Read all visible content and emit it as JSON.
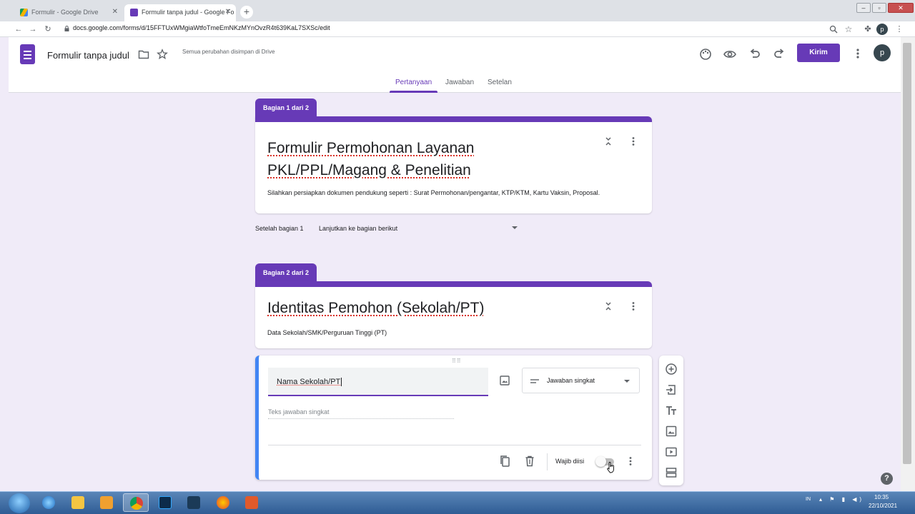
{
  "browser": {
    "tabs": [
      {
        "title": "Formulir - Google Drive",
        "active": false
      },
      {
        "title": "Formulir tanpa judul - Google Fo",
        "active": true
      }
    ],
    "url": "docs.google.com/forms/d/15FFTUxWMgiaWtfoTmeEmNKzMYnOvzR4t639KaL7SXSc/edit",
    "close_glyph": "✕",
    "new_tab_glyph": "+"
  },
  "header": {
    "title": "Formulir tanpa judul",
    "save_status": "Semua perubahan disimpan di Drive",
    "send_label": "Kirim",
    "avatar_letter": "p"
  },
  "tabs": [
    {
      "label": "Pertanyaan",
      "active": true
    },
    {
      "label": "Jawaban",
      "active": false
    },
    {
      "label": "Setelan",
      "active": false
    }
  ],
  "section1": {
    "badge": "Bagian 1 dari 2",
    "title_line1": "Formulir Permohonan Layanan",
    "title_line2": "PKL/PPL/Magang & Penelitian",
    "description": "Silahkan persiapkan dokumen pendukung seperti : Surat Permohonan/pengantar, KTP/KTM, Kartu Vaksin, Proposal."
  },
  "after_section": {
    "label": "Setelah bagian 1",
    "value": "Lanjutkan ke bagian berikut"
  },
  "section2": {
    "badge": "Bagian 2 dari 2",
    "title": "Identitas Pemohon (Sekolah/PT)",
    "description": "Data Sekolah/SMK/Perguruan Tinggi (PT)"
  },
  "question": {
    "title": "Nama Sekolah/PT",
    "type": "Jawaban singkat",
    "answer_placeholder": "Teks jawaban singkat",
    "required_label": "Wajib diisi",
    "required": false
  },
  "help_glyph": "?",
  "taskbar": {
    "language": "IN",
    "time": "10:35",
    "date": "22/10/2021"
  },
  "colors": {
    "accent": "#673ab7",
    "background": "#f0ebf8",
    "question_highlight": "#4285f4"
  }
}
